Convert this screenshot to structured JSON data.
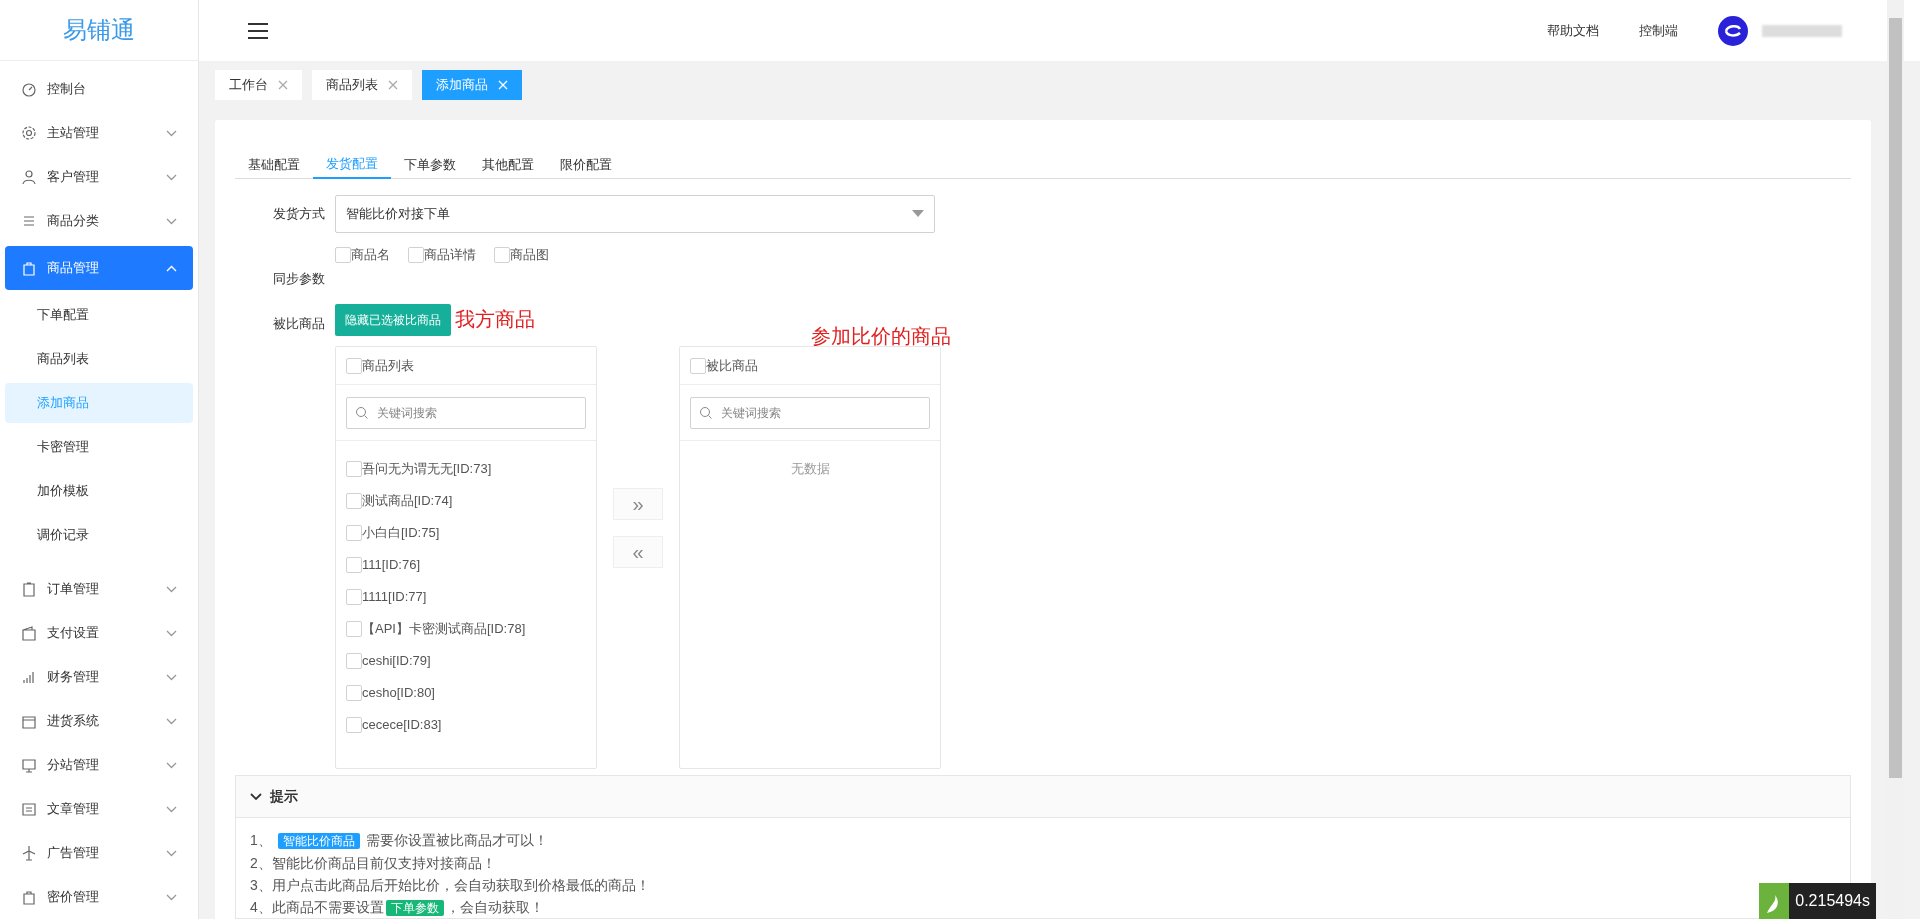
{
  "logo": "易铺通",
  "sidebar": {
    "items": [
      {
        "label": "控制台"
      },
      {
        "label": "主站管理",
        "expanded": false
      },
      {
        "label": "客户管理",
        "expanded": false
      },
      {
        "label": "商品分类",
        "expanded": false
      },
      {
        "label": "商品管理",
        "expanded": true,
        "selected": true,
        "children": [
          {
            "label": "下单配置",
            "selected": false
          },
          {
            "label": "商品列表",
            "selected": false
          },
          {
            "label": "添加商品",
            "selected": true
          },
          {
            "label": "卡密管理",
            "selected": false
          },
          {
            "label": "加价模板",
            "selected": false
          },
          {
            "label": "调价记录",
            "selected": false
          }
        ]
      },
      {
        "label": "订单管理",
        "expanded": false
      },
      {
        "label": "支付设置",
        "expanded": false
      },
      {
        "label": "财务管理",
        "expanded": false
      },
      {
        "label": "进货系统",
        "expanded": false
      },
      {
        "label": "分站管理",
        "expanded": false
      },
      {
        "label": "文章管理",
        "expanded": false
      },
      {
        "label": "广告管理",
        "expanded": false
      },
      {
        "label": "密价管理",
        "expanded": false
      }
    ]
  },
  "header": {
    "links": [
      "帮助文档",
      "控制端"
    ]
  },
  "page_tabs": [
    {
      "label": "工作台",
      "selected": false
    },
    {
      "label": "商品列表",
      "selected": false
    },
    {
      "label": "添加商品",
      "selected": true
    }
  ],
  "form_tabs": [
    {
      "label": "基础配置",
      "selected": false
    },
    {
      "label": "发货配置",
      "selected": true
    },
    {
      "label": "下单参数",
      "selected": false
    },
    {
      "label": "其他配置",
      "selected": false
    },
    {
      "label": "限价配置",
      "selected": false
    }
  ],
  "delivery": {
    "label": "发货方式",
    "value": "智能比价对接下单"
  },
  "sync": {
    "label": "同步参数",
    "options": [
      {
        "label": "商品名",
        "checked": false
      },
      {
        "label": "商品详情",
        "checked": false
      },
      {
        "label": "商品图",
        "checked": false
      }
    ]
  },
  "compare": {
    "label": "被比商品",
    "hide_button": "隐藏已选被比商品",
    "annotations": [
      "我方商品",
      "参加比价的商品"
    ],
    "left": {
      "title": "商品列表",
      "checked": false,
      "placeholder": "关键词搜索",
      "items": [
        {
          "label": "吾问无为谓无无[ID:73]",
          "checked": false
        },
        {
          "label": "测试商品[ID:74]",
          "checked": false
        },
        {
          "label": "小白白[ID:75]",
          "checked": false
        },
        {
          "label": "111[ID:76]",
          "checked": false
        },
        {
          "label": "1111[ID:77]",
          "checked": false
        },
        {
          "label": "【API】卡密测试商品[ID:78]",
          "checked": false
        },
        {
          "label": "ceshi[ID:79]",
          "checked": false
        },
        {
          "label": "cesho[ID:80]",
          "checked": false
        },
        {
          "label": "cecece[ID:83]",
          "checked": false
        }
      ]
    },
    "right": {
      "title": "被比商品",
      "checked": false,
      "placeholder": "关键词搜索",
      "empty": "无数据"
    },
    "move_buttons": [
      "»",
      "«"
    ]
  },
  "tips": {
    "title": "提示",
    "expanded": true,
    "lines": [
      [
        {
          "kind": "text",
          "text": "1、 "
        },
        {
          "kind": "badge",
          "text": "智能比价商品",
          "color": "#1e9fff"
        },
        {
          "kind": "text",
          "text": " 需要你设置被比商品才可以！"
        }
      ],
      [
        {
          "kind": "text",
          "text": "2、智能比价商品目前仅支持对接商品！"
        }
      ],
      [
        {
          "kind": "text",
          "text": "3、用户点击此商品后开始比价，会自动获取到价格最低的商品！"
        }
      ],
      [
        {
          "kind": "text",
          "text": "4、此商品不需要设置"
        },
        {
          "kind": "badge",
          "text": "下单参数",
          "color": "#16b777"
        },
        {
          "kind": "text",
          "text": "，会自动获取！"
        }
      ]
    ]
  },
  "timer": "0.215494s"
}
